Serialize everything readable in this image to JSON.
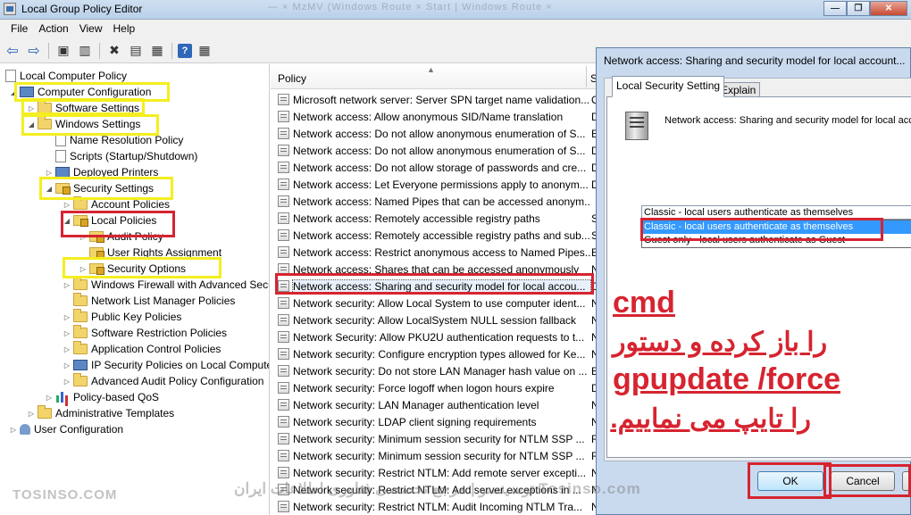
{
  "window": {
    "title": "Local Group Policy Editor",
    "background_tabs": "— ×  MzMV (Windows Route  ×  Start | Windows Route ×",
    "minimize": "—",
    "maximize": "❐",
    "close": "✕"
  },
  "menu": {
    "file": "File",
    "action": "Action",
    "view": "View",
    "help": "Help"
  },
  "toolbar": {
    "back": "⇦",
    "forward": "⇨",
    "up": "▣",
    "show_hide": "▥",
    "delete": "✖",
    "properties": "▤",
    "export": "▦",
    "help": "?",
    "filter": "▦"
  },
  "tree": {
    "local_computer_policy": "Local Computer Policy",
    "computer_configuration": "Computer Configuration",
    "software_settings": "Software Settings",
    "windows_settings": "Windows Settings",
    "name_resolution_policy": "Name Resolution Policy",
    "scripts": "Scripts (Startup/Shutdown)",
    "deployed_printers": "Deployed Printers",
    "security_settings": "Security Settings",
    "account_policies": "Account Policies",
    "local_policies": "Local Policies",
    "audit_policy": "Audit Policy",
    "user_rights_assignment": "User Rights Assignment",
    "security_options": "Security Options",
    "windows_firewall": "Windows Firewall with Advanced Secu",
    "network_list_manager": "Network List Manager Policies",
    "public_key_policies": "Public Key Policies",
    "software_restriction": "Software Restriction Policies",
    "application_control": "Application Control Policies",
    "ip_security": "IP Security Policies on Local Compute",
    "advanced_audit": "Advanced Audit Policy Configuration",
    "policy_based_qos": "Policy-based QoS",
    "administrative_templates": "Administrative Templates",
    "user_configuration": "User Configuration"
  },
  "list": {
    "column_policy": "Policy",
    "column_setting": "S",
    "rows": [
      {
        "policy": "Microsoft network server: Server SPN target name validation...",
        "setting": "O"
      },
      {
        "policy": "Network access: Allow anonymous SID/Name translation",
        "setting": "D"
      },
      {
        "policy": "Network access: Do not allow anonymous enumeration of S...",
        "setting": "E"
      },
      {
        "policy": "Network access: Do not allow anonymous enumeration of S...",
        "setting": "D"
      },
      {
        "policy": "Network access: Do not allow storage of passwords and cre...",
        "setting": "D"
      },
      {
        "policy": "Network access: Let Everyone permissions apply to anonym...",
        "setting": "D"
      },
      {
        "policy": "Network access: Named Pipes that can be accessed anonym...",
        "setting": ""
      },
      {
        "policy": "Network access: Remotely accessible registry paths",
        "setting": "S"
      },
      {
        "policy": "Network access: Remotely accessible registry paths and sub...",
        "setting": "S"
      },
      {
        "policy": "Network access: Restrict anonymous access to Named Pipes...",
        "setting": "E"
      },
      {
        "policy": "Network access: Shares that can be accessed anonymously",
        "setting": "N"
      },
      {
        "policy": "Network access: Sharing and security model for local accou...",
        "setting": "C"
      },
      {
        "policy": "Network security: Allow Local System to use computer ident...",
        "setting": "N"
      },
      {
        "policy": "Network security: Allow LocalSystem NULL session fallback",
        "setting": "N"
      },
      {
        "policy": "Network Security: Allow PKU2U authentication requests to t...",
        "setting": "N"
      },
      {
        "policy": "Network security: Configure encryption types allowed for Ke...",
        "setting": "N"
      },
      {
        "policy": "Network security: Do not store LAN Manager hash value on ...",
        "setting": "E"
      },
      {
        "policy": "Network security: Force logoff when logon hours expire",
        "setting": "D"
      },
      {
        "policy": "Network security: LAN Manager authentication level",
        "setting": "N"
      },
      {
        "policy": "Network security: LDAP client signing requirements",
        "setting": "N"
      },
      {
        "policy": "Network security: Minimum session security for NTLM SSP ...",
        "setting": "R"
      },
      {
        "policy": "Network security: Minimum session security for NTLM SSP ...",
        "setting": "R"
      },
      {
        "policy": "Network security: Restrict NTLM: Add remote server excepti...",
        "setting": "N"
      },
      {
        "policy": "Network security: Restrict NTLM: Add server exceptions in ...",
        "setting": "N"
      },
      {
        "policy": "Network security: Restrict NTLM: Audit Incoming NTLM Tra...",
        "setting": "Not Defined"
      }
    ]
  },
  "dialog": {
    "title": "Network access: Sharing and security model for local account...",
    "tab_local": "Local Security Setting",
    "tab_explain": "Explain",
    "policy_name": "Network access: Sharing and security model for local accou",
    "combo_value": "Classic - local users authenticate as themselves",
    "options": [
      "Classic - local users authenticate as themselves",
      "Guest only - local users authenticate as Guest"
    ],
    "ok": "OK",
    "cancel": "Cancel"
  },
  "annotation": {
    "line1": "cmd",
    "line2": "را باز کرده و دستور",
    "line3": "gpupdate /force",
    "line4": "را تایپ می نماییم.",
    "color": "#d62430"
  },
  "watermark": {
    "left": "TOSINSO.COM",
    "center": "توسینسو | مرجع تخصصی فناوری اطلاعات ایران Tosinso.com"
  },
  "colors": {
    "highlight_yellow": "#f4ee1f",
    "highlight_red": "#d62430",
    "selection_blue": "#3399ff"
  }
}
